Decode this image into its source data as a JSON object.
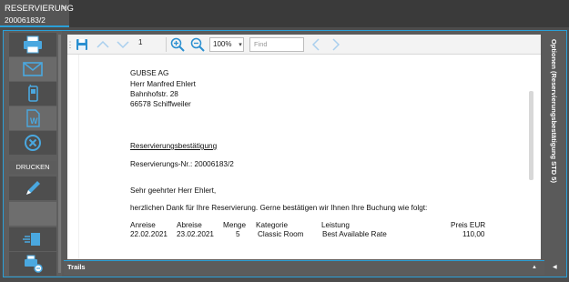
{
  "tab": {
    "title": "RESERVIERUNG",
    "close_glyph": "×",
    "subtitle": "20006183/2"
  },
  "sidebar": {
    "buttons": [
      {
        "name": "print-button",
        "icon": "printer-icon"
      },
      {
        "name": "email-button",
        "icon": "envelope-icon"
      },
      {
        "name": "phone-button",
        "icon": "phone-icon"
      },
      {
        "name": "word-button",
        "icon": "word-document-icon"
      },
      {
        "name": "cancel-button",
        "icon": "cancel-circle-icon"
      },
      {
        "name": "edit-button",
        "icon": "pencil-icon"
      },
      {
        "name": "fast-send-button",
        "icon": "fast-print-icon"
      },
      {
        "name": "printer-settings-button",
        "icon": "printer-settings-icon"
      }
    ],
    "section_label": "DRUCKEN"
  },
  "toolbar": {
    "page_number": "1",
    "zoom": "100%",
    "zoom_caret": "▾",
    "find_placeholder": "Find"
  },
  "document": {
    "address": [
      "GUBSE AG",
      "Herr Manfred Ehlert",
      "Bahnhofstr. 28",
      "66578 Schiffweiler"
    ],
    "heading": "Reservierungsbestätigung",
    "reservation_no": "Reservierungs-Nr.: 20006183/2",
    "salutation": "Sehr geehrter Herr Ehlert,",
    "intro": "herzlichen Dank für Ihre Reservierung. Gerne bestätigen wir Ihnen Ihre Buchung wie folgt:",
    "table": {
      "headers": {
        "arrival": "Anreise",
        "departure": "Abreise",
        "qty": "Menge",
        "category": "Kategorie",
        "service": "Leistung",
        "price": "Preis EUR"
      },
      "row": {
        "arrival": "22.02.2021",
        "departure": "23.02.2021",
        "qty": "5",
        "category": "Classic Room",
        "service": "Best Available Rate",
        "price": "110,00"
      }
    }
  },
  "options_panel": {
    "label": "Optionen (Reservierungsbestätigung STD 5)",
    "arrow": "◀"
  },
  "trails": {
    "label": "Trails",
    "arrow": "▲"
  },
  "colors": {
    "accent": "#2aa0d8",
    "icon_blue": "#4aa8e0"
  }
}
